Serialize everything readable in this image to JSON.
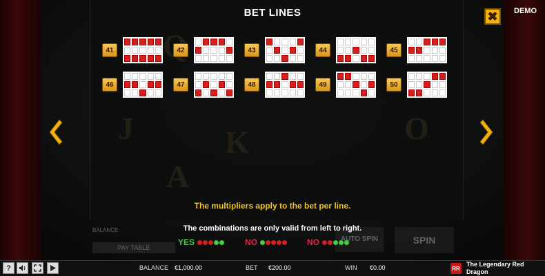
{
  "header": {
    "title": "BET LINES",
    "demo_label": "DEMO",
    "close_symbol": "✖"
  },
  "lines": [
    {
      "number": "41",
      "pattern": [
        [
          1,
          1,
          1,
          1,
          1
        ],
        [
          0,
          0,
          0,
          0,
          0
        ],
        [
          1,
          1,
          1,
          1,
          1
        ]
      ]
    },
    {
      "number": "42",
      "pattern": [
        [
          0,
          1,
          1,
          1,
          0
        ],
        [
          1,
          0,
          0,
          0,
          1
        ],
        [
          0,
          0,
          0,
          0,
          0
        ]
      ]
    },
    {
      "number": "43",
      "pattern": [
        [
          1,
          0,
          0,
          0,
          1
        ],
        [
          0,
          1,
          0,
          1,
          0
        ],
        [
          0,
          0,
          1,
          0,
          0
        ]
      ]
    },
    {
      "number": "44",
      "pattern": [
        [
          0,
          0,
          0,
          0,
          0
        ],
        [
          0,
          0,
          1,
          0,
          0
        ],
        [
          1,
          1,
          0,
          1,
          1
        ]
      ]
    },
    {
      "number": "45",
      "pattern": [
        [
          0,
          0,
          1,
          1,
          1
        ],
        [
          1,
          1,
          0,
          0,
          0
        ],
        [
          0,
          0,
          0,
          0,
          0
        ]
      ]
    },
    {
      "number": "46",
      "pattern": [
        [
          0,
          0,
          0,
          0,
          0
        ],
        [
          1,
          1,
          0,
          1,
          1
        ],
        [
          0,
          0,
          1,
          0,
          0
        ]
      ]
    },
    {
      "number": "47",
      "pattern": [
        [
          0,
          0,
          0,
          0,
          0
        ],
        [
          0,
          1,
          0,
          1,
          0
        ],
        [
          1,
          0,
          1,
          0,
          1
        ]
      ]
    },
    {
      "number": "48",
      "pattern": [
        [
          0,
          0,
          1,
          0,
          0
        ],
        [
          1,
          1,
          0,
          1,
          1
        ],
        [
          0,
          0,
          0,
          0,
          0
        ]
      ]
    },
    {
      "number": "49",
      "pattern": [
        [
          1,
          1,
          0,
          0,
          0
        ],
        [
          0,
          0,
          1,
          0,
          1
        ],
        [
          0,
          0,
          0,
          1,
          0
        ]
      ]
    },
    {
      "number": "50",
      "pattern": [
        [
          0,
          0,
          0,
          1,
          1
        ],
        [
          0,
          0,
          1,
          0,
          0
        ],
        [
          1,
          1,
          0,
          0,
          0
        ]
      ]
    }
  ],
  "info": {
    "multiplier_text": "The multipliers apply to the bet per line.",
    "combination_text": "The combinations are only valid from left to right."
  },
  "examples": [
    {
      "label": "YES",
      "color": "#3fd13f",
      "dots": [
        "#d41f1f",
        "#d41f1f",
        "#d41f1f",
        "#3fd13f",
        "#3fd13f"
      ]
    },
    {
      "label": "NO",
      "color": "#e0234a",
      "dots": [
        "#3fd13f",
        "#d41f1f",
        "#d41f1f",
        "#d41f1f",
        "#d41f1f"
      ]
    },
    {
      "label": "NO",
      "color": "#e0234a",
      "dots": [
        "#d41f1f",
        "#d41f1f",
        "#3fd13f",
        "#3fd13f",
        "#3fd13f"
      ]
    }
  ],
  "background_ui": {
    "balance_label": "BALANCE",
    "paytable_label": "PAY TABLE",
    "autospin_label": "AUTO SPIN",
    "spin_label": "SPIN"
  },
  "bottom_bar": {
    "help_icon": "?",
    "sound_icon": "🔈",
    "balance_label": "BALANCE",
    "balance_value": "€1,000.00",
    "bet_label": "BET",
    "bet_value": "€200.00",
    "win_label": "WIN",
    "win_value": "€0.00",
    "logo_text": "RR",
    "game_name": "The Legendary Red Dragon"
  },
  "colors": {
    "accent_gold": "#f2c229",
    "line_red": "#d41f1f",
    "yes_green": "#3fd13f",
    "no_red": "#e0234a"
  }
}
